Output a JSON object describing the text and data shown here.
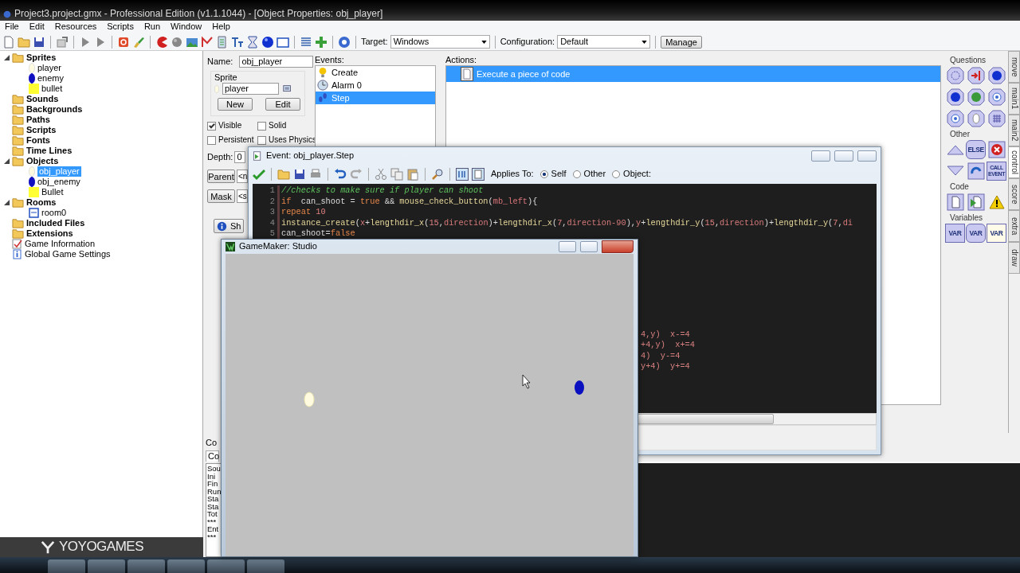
{
  "window": {
    "title": "Project3.project.gmx  -  Professional Edition (v1.1.1044) - [Object Properties: obj_player]"
  },
  "menu": [
    "File",
    "Edit",
    "Resources",
    "Scripts",
    "Run",
    "Window",
    "Help"
  ],
  "toolbar": {
    "target_label": "Target:",
    "target": "Windows",
    "config_label": "Configuration:",
    "config": "Default",
    "manage": "Manage"
  },
  "tree": [
    {
      "label": "Sprites",
      "kind": "folder",
      "expanded": true,
      "selected": false,
      "children": [
        {
          "label": "player",
          "kind": "ball",
          "color": "#fffbe0",
          "selected": false
        },
        {
          "label": "enemy",
          "kind": "ball",
          "color": "#1010c0",
          "selected": false
        },
        {
          "label": "bullet",
          "kind": "block",
          "color": "#ffff33",
          "selected": false
        }
      ]
    },
    {
      "label": "Sounds",
      "kind": "folder",
      "selected": false
    },
    {
      "label": "Backgrounds",
      "kind": "folder",
      "selected": false
    },
    {
      "label": "Paths",
      "kind": "folder",
      "selected": false
    },
    {
      "label": "Scripts",
      "kind": "folder",
      "selected": false
    },
    {
      "label": "Fonts",
      "kind": "folder",
      "selected": false
    },
    {
      "label": "Time Lines",
      "kind": "folder",
      "selected": false
    },
    {
      "label": "Objects",
      "kind": "folder",
      "expanded": true,
      "selected": false,
      "children": [
        {
          "label": "obj_player",
          "kind": "ball",
          "color": "#fffbe0",
          "selected": true
        },
        {
          "label": "obj_enemy",
          "kind": "ball",
          "color": "#1010c0",
          "selected": false
        },
        {
          "label": "Bullet",
          "kind": "block",
          "color": "#ffff33",
          "selected": false
        }
      ]
    },
    {
      "label": "Rooms",
      "kind": "folder",
      "expanded": true,
      "selected": false,
      "children": [
        {
          "label": "room0",
          "kind": "room",
          "selected": false
        }
      ]
    },
    {
      "label": "Included Files",
      "kind": "folder",
      "selected": false
    },
    {
      "label": "Extensions",
      "kind": "folder",
      "selected": false
    },
    {
      "label": "Game Information",
      "kind": "info",
      "selected": false
    },
    {
      "label": "Global Game Settings",
      "kind": "settings",
      "selected": false
    }
  ],
  "logo": "YOYOGAMES",
  "object": {
    "name_label": "Name:",
    "name": "obj_player",
    "sprite_label": "Sprite",
    "sprite": "player",
    "new": "New",
    "edit": "Edit",
    "checks": [
      {
        "label": "Visible",
        "checked": true
      },
      {
        "label": "Solid",
        "checked": false
      },
      {
        "label": "Persistent",
        "checked": false
      },
      {
        "label": "Uses Physics",
        "checked": false
      }
    ],
    "depth_label": "Depth:",
    "depth": "0",
    "parent": "Parent",
    "parent_value": "<n",
    "mask": "Mask",
    "mask_value": "<s",
    "show": "Sh"
  },
  "events": {
    "label": "Events:",
    "items": [
      {
        "label": "Create",
        "kind": "bulb",
        "selected": false
      },
      {
        "label": "Alarm 0",
        "kind": "clock",
        "selected": false
      },
      {
        "label": "Step",
        "kind": "step",
        "selected": true
      }
    ]
  },
  "actions": {
    "label": "Actions:",
    "items": [
      {
        "label": "Execute a piece of code",
        "selected": true
      }
    ]
  },
  "palette": {
    "groups": [
      {
        "label": "Questions",
        "buttons": [
          {
            "kind": "ring"
          },
          {
            "kind": "exit"
          },
          {
            "kind": "ball"
          },
          {
            "kind": "ball"
          },
          {
            "kind": "dice"
          },
          {
            "kind": "help"
          },
          {
            "kind": "help"
          },
          {
            "kind": "mouse"
          },
          {
            "kind": "grid"
          }
        ]
      },
      {
        "label": "Other",
        "buttons": [
          {
            "kind": "up"
          },
          {
            "kind": "octagon",
            "text": "ELSE"
          },
          {
            "kind": "cross"
          },
          {
            "kind": "down"
          },
          {
            "kind": "repeat"
          },
          {
            "kind": "square",
            "text": "CALL EVENT"
          }
        ]
      },
      {
        "label": "Code",
        "buttons": [
          {
            "kind": "page"
          },
          {
            "kind": "run"
          },
          {
            "kind": "warning"
          }
        ]
      },
      {
        "label": "Variables",
        "buttons": [
          {
            "kind": "square",
            "text": "VAR"
          },
          {
            "kind": "octagon",
            "text": "VAR"
          },
          {
            "kind": "pale",
            "text": "VAR"
          }
        ]
      }
    ]
  },
  "tabs": [
    {
      "label": "move",
      "selected": false
    },
    {
      "label": "main1",
      "selected": false
    },
    {
      "label": "main2",
      "selected": false
    },
    {
      "label": "control",
      "selected": true
    },
    {
      "label": "score",
      "selected": false
    },
    {
      "label": "extra",
      "selected": false
    },
    {
      "label": "draw",
      "selected": false
    }
  ],
  "console": {
    "title": "Co",
    "tab": "Co",
    "lines": [
      "Sou",
      "Ini",
      "Fin",
      "Run",
      "Sta",
      "Sta",
      "Tot",
      "***",
      "Ent",
      "***"
    ]
  },
  "editor": {
    "title": "Event: obj_player.Step",
    "applies_label": "Applies To:",
    "applies": [
      {
        "label": "Self",
        "selected": true
      },
      {
        "label": "Other",
        "selected": false
      },
      {
        "label": "Object:",
        "selected": false
      }
    ],
    "lines": [
      {
        "number": "1",
        "tokens": [
          {
            "text": "//checks to make sure if player can shoot",
            "kind": "comment"
          }
        ]
      },
      {
        "number": "2",
        "tokens": [
          {
            "text": "if",
            "kind": "keyword"
          },
          {
            "text": "  can_shoot = ",
            "kind": "plain"
          },
          {
            "text": "true",
            "kind": "keyword"
          },
          {
            "text": " && ",
            "kind": "plain"
          },
          {
            "text": "mouse_check_button",
            "kind": "function"
          },
          {
            "text": "(",
            "kind": "plain"
          },
          {
            "text": "mb_left",
            "kind": "constant"
          },
          {
            "text": "){",
            "kind": "plain"
          }
        ]
      },
      {
        "number": "3",
        "tokens": [
          {
            "text": "repeat",
            "kind": "keyword"
          },
          {
            "text": " 10",
            "kind": "number"
          }
        ]
      },
      {
        "number": "4",
        "tokens": [
          {
            "text": "instance_create",
            "kind": "function"
          },
          {
            "text": "(",
            "kind": "plain"
          },
          {
            "text": "x",
            "kind": "variable"
          },
          {
            "text": "+",
            "kind": "plain"
          },
          {
            "text": "lengthdir_x",
            "kind": "function"
          },
          {
            "text": "(",
            "kind": "plain"
          },
          {
            "text": "15",
            "kind": "number"
          },
          {
            "text": ",",
            "kind": "plain"
          },
          {
            "text": "direction",
            "kind": "variable"
          },
          {
            "text": ")+",
            "kind": "plain"
          },
          {
            "text": "lengthdir_x",
            "kind": "function"
          },
          {
            "text": "(",
            "kind": "plain"
          },
          {
            "text": "7",
            "kind": "number"
          },
          {
            "text": ",",
            "kind": "plain"
          },
          {
            "text": "direction-90",
            "kind": "variable"
          },
          {
            "text": "),",
            "kind": "plain"
          },
          {
            "text": "y",
            "kind": "variable"
          },
          {
            "text": "+",
            "kind": "plain"
          },
          {
            "text": "lengthdir_y",
            "kind": "function"
          },
          {
            "text": "(",
            "kind": "plain"
          },
          {
            "text": "15",
            "kind": "number"
          },
          {
            "text": ",",
            "kind": "plain"
          },
          {
            "text": "direction",
            "kind": "variable"
          },
          {
            "text": ")+",
            "kind": "plain"
          },
          {
            "text": "lengthdir_y",
            "kind": "function"
          },
          {
            "text": "(",
            "kind": "plain"
          },
          {
            "text": "7",
            "kind": "number"
          },
          {
            "text": ",",
            "kind": "plain"
          },
          {
            "text": "di",
            "kind": "variable"
          }
        ]
      },
      {
        "number": "5",
        "tokens": [
          {
            "text": "can_shoot=",
            "kind": "plain"
          },
          {
            "text": "false",
            "kind": "keyword"
          }
        ]
      }
    ],
    "fragments": [
      "4,y)  x-=4",
      "+4,y)  x+=4",
      "4)  y-=4",
      "y+4)  y+=4"
    ]
  },
  "game": {
    "title": "GameMaker: Studio"
  }
}
